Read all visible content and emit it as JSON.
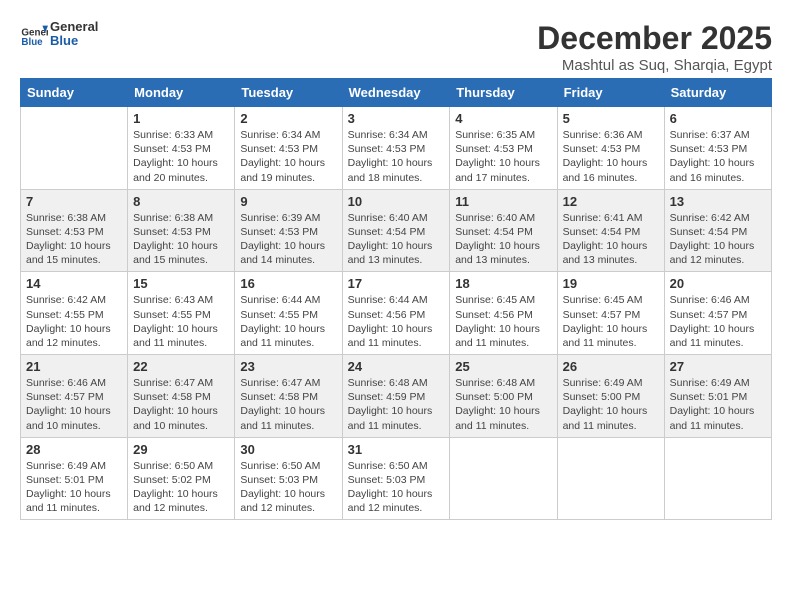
{
  "header": {
    "logo_general": "General",
    "logo_blue": "Blue",
    "month_title": "December 2025",
    "location": "Mashtul as Suq, Sharqia, Egypt"
  },
  "days_of_week": [
    "Sunday",
    "Monday",
    "Tuesday",
    "Wednesday",
    "Thursday",
    "Friday",
    "Saturday"
  ],
  "weeks": [
    [
      {
        "day": "",
        "sunrise": "",
        "sunset": "",
        "daylight": ""
      },
      {
        "day": "1",
        "sunrise": "Sunrise: 6:33 AM",
        "sunset": "Sunset: 4:53 PM",
        "daylight": "Daylight: 10 hours and 20 minutes."
      },
      {
        "day": "2",
        "sunrise": "Sunrise: 6:34 AM",
        "sunset": "Sunset: 4:53 PM",
        "daylight": "Daylight: 10 hours and 19 minutes."
      },
      {
        "day": "3",
        "sunrise": "Sunrise: 6:34 AM",
        "sunset": "Sunset: 4:53 PM",
        "daylight": "Daylight: 10 hours and 18 minutes."
      },
      {
        "day": "4",
        "sunrise": "Sunrise: 6:35 AM",
        "sunset": "Sunset: 4:53 PM",
        "daylight": "Daylight: 10 hours and 17 minutes."
      },
      {
        "day": "5",
        "sunrise": "Sunrise: 6:36 AM",
        "sunset": "Sunset: 4:53 PM",
        "daylight": "Daylight: 10 hours and 16 minutes."
      },
      {
        "day": "6",
        "sunrise": "Sunrise: 6:37 AM",
        "sunset": "Sunset: 4:53 PM",
        "daylight": "Daylight: 10 hours and 16 minutes."
      }
    ],
    [
      {
        "day": "7",
        "sunrise": "Sunrise: 6:38 AM",
        "sunset": "Sunset: 4:53 PM",
        "daylight": "Daylight: 10 hours and 15 minutes."
      },
      {
        "day": "8",
        "sunrise": "Sunrise: 6:38 AM",
        "sunset": "Sunset: 4:53 PM",
        "daylight": "Daylight: 10 hours and 15 minutes."
      },
      {
        "day": "9",
        "sunrise": "Sunrise: 6:39 AM",
        "sunset": "Sunset: 4:53 PM",
        "daylight": "Daylight: 10 hours and 14 minutes."
      },
      {
        "day": "10",
        "sunrise": "Sunrise: 6:40 AM",
        "sunset": "Sunset: 4:54 PM",
        "daylight": "Daylight: 10 hours and 13 minutes."
      },
      {
        "day": "11",
        "sunrise": "Sunrise: 6:40 AM",
        "sunset": "Sunset: 4:54 PM",
        "daylight": "Daylight: 10 hours and 13 minutes."
      },
      {
        "day": "12",
        "sunrise": "Sunrise: 6:41 AM",
        "sunset": "Sunset: 4:54 PM",
        "daylight": "Daylight: 10 hours and 13 minutes."
      },
      {
        "day": "13",
        "sunrise": "Sunrise: 6:42 AM",
        "sunset": "Sunset: 4:54 PM",
        "daylight": "Daylight: 10 hours and 12 minutes."
      }
    ],
    [
      {
        "day": "14",
        "sunrise": "Sunrise: 6:42 AM",
        "sunset": "Sunset: 4:55 PM",
        "daylight": "Daylight: 10 hours and 12 minutes."
      },
      {
        "day": "15",
        "sunrise": "Sunrise: 6:43 AM",
        "sunset": "Sunset: 4:55 PM",
        "daylight": "Daylight: 10 hours and 11 minutes."
      },
      {
        "day": "16",
        "sunrise": "Sunrise: 6:44 AM",
        "sunset": "Sunset: 4:55 PM",
        "daylight": "Daylight: 10 hours and 11 minutes."
      },
      {
        "day": "17",
        "sunrise": "Sunrise: 6:44 AM",
        "sunset": "Sunset: 4:56 PM",
        "daylight": "Daylight: 10 hours and 11 minutes."
      },
      {
        "day": "18",
        "sunrise": "Sunrise: 6:45 AM",
        "sunset": "Sunset: 4:56 PM",
        "daylight": "Daylight: 10 hours and 11 minutes."
      },
      {
        "day": "19",
        "sunrise": "Sunrise: 6:45 AM",
        "sunset": "Sunset: 4:57 PM",
        "daylight": "Daylight: 10 hours and 11 minutes."
      },
      {
        "day": "20",
        "sunrise": "Sunrise: 6:46 AM",
        "sunset": "Sunset: 4:57 PM",
        "daylight": "Daylight: 10 hours and 11 minutes."
      }
    ],
    [
      {
        "day": "21",
        "sunrise": "Sunrise: 6:46 AM",
        "sunset": "Sunset: 4:57 PM",
        "daylight": "Daylight: 10 hours and 10 minutes."
      },
      {
        "day": "22",
        "sunrise": "Sunrise: 6:47 AM",
        "sunset": "Sunset: 4:58 PM",
        "daylight": "Daylight: 10 hours and 10 minutes."
      },
      {
        "day": "23",
        "sunrise": "Sunrise: 6:47 AM",
        "sunset": "Sunset: 4:58 PM",
        "daylight": "Daylight: 10 hours and 11 minutes."
      },
      {
        "day": "24",
        "sunrise": "Sunrise: 6:48 AM",
        "sunset": "Sunset: 4:59 PM",
        "daylight": "Daylight: 10 hours and 11 minutes."
      },
      {
        "day": "25",
        "sunrise": "Sunrise: 6:48 AM",
        "sunset": "Sunset: 5:00 PM",
        "daylight": "Daylight: 10 hours and 11 minutes."
      },
      {
        "day": "26",
        "sunrise": "Sunrise: 6:49 AM",
        "sunset": "Sunset: 5:00 PM",
        "daylight": "Daylight: 10 hours and 11 minutes."
      },
      {
        "day": "27",
        "sunrise": "Sunrise: 6:49 AM",
        "sunset": "Sunset: 5:01 PM",
        "daylight": "Daylight: 10 hours and 11 minutes."
      }
    ],
    [
      {
        "day": "28",
        "sunrise": "Sunrise: 6:49 AM",
        "sunset": "Sunset: 5:01 PM",
        "daylight": "Daylight: 10 hours and 11 minutes."
      },
      {
        "day": "29",
        "sunrise": "Sunrise: 6:50 AM",
        "sunset": "Sunset: 5:02 PM",
        "daylight": "Daylight: 10 hours and 12 minutes."
      },
      {
        "day": "30",
        "sunrise": "Sunrise: 6:50 AM",
        "sunset": "Sunset: 5:03 PM",
        "daylight": "Daylight: 10 hours and 12 minutes."
      },
      {
        "day": "31",
        "sunrise": "Sunrise: 6:50 AM",
        "sunset": "Sunset: 5:03 PM",
        "daylight": "Daylight: 10 hours and 12 minutes."
      },
      {
        "day": "",
        "sunrise": "",
        "sunset": "",
        "daylight": ""
      },
      {
        "day": "",
        "sunrise": "",
        "sunset": "",
        "daylight": ""
      },
      {
        "day": "",
        "sunrise": "",
        "sunset": "",
        "daylight": ""
      }
    ]
  ]
}
